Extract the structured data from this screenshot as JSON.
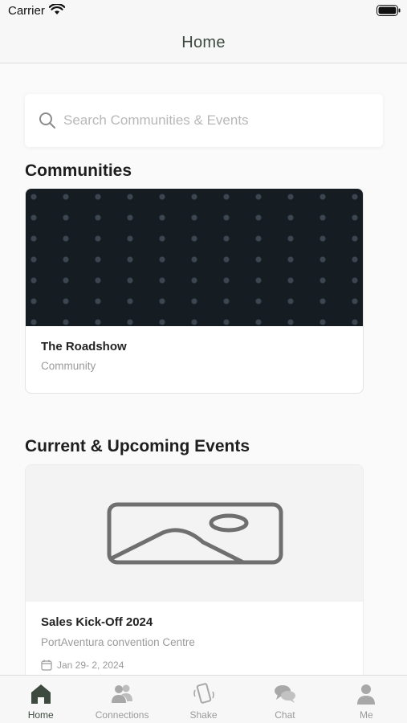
{
  "status_bar": {
    "carrier": "Carrier"
  },
  "nav": {
    "title": "Home"
  },
  "search": {
    "placeholder": "Search Communities & Events"
  },
  "communities": {
    "heading": "Communities",
    "items": [
      {
        "title": "The Roadshow",
        "subtitle": "Community"
      }
    ]
  },
  "events": {
    "heading": "Current & Upcoming Events",
    "items": [
      {
        "title": "Sales Kick-Off 2024",
        "location": "PortAventura convention Centre",
        "date": "Jan 29- 2, 2024"
      }
    ]
  },
  "tabs": [
    {
      "label": "Home",
      "icon": "home-icon",
      "active": true
    },
    {
      "label": "Connections",
      "icon": "connections-icon",
      "active": false
    },
    {
      "label": "Shake",
      "icon": "shake-icon",
      "active": false
    },
    {
      "label": "Chat",
      "icon": "chat-icon",
      "active": false
    },
    {
      "label": "Me",
      "icon": "me-icon",
      "active": false
    }
  ],
  "colors": {
    "accent": "#3d4a40",
    "inactive": "#9a9a9a",
    "banner": "#151c22"
  }
}
